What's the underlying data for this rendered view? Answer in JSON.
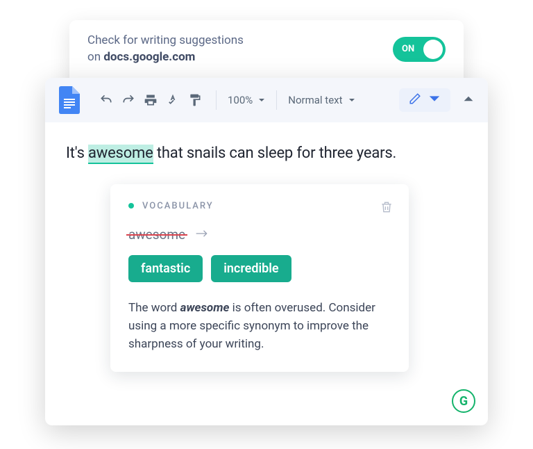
{
  "extension": {
    "text_line1": "Check for writing suggestions",
    "text_line2_prefix": "on ",
    "text_line2_domain": "docs.google.com",
    "toggle_label": "ON"
  },
  "toolbar": {
    "zoom": "100%",
    "style": "Normal text"
  },
  "document": {
    "sentence_pre": "It's ",
    "sentence_hl": "awesome",
    "sentence_post": " that snails can sleep for three years."
  },
  "card": {
    "category": "VOCABULARY",
    "strikethrough": "awesome",
    "suggestions": [
      "fantastic",
      "incredible"
    ],
    "explain_pre": "The word ",
    "explain_word": "awesome",
    "explain_post": " is often overused. Consider using a more specific synonym to improve the sharpness of your writing."
  },
  "badge": {
    "letter": "G"
  }
}
